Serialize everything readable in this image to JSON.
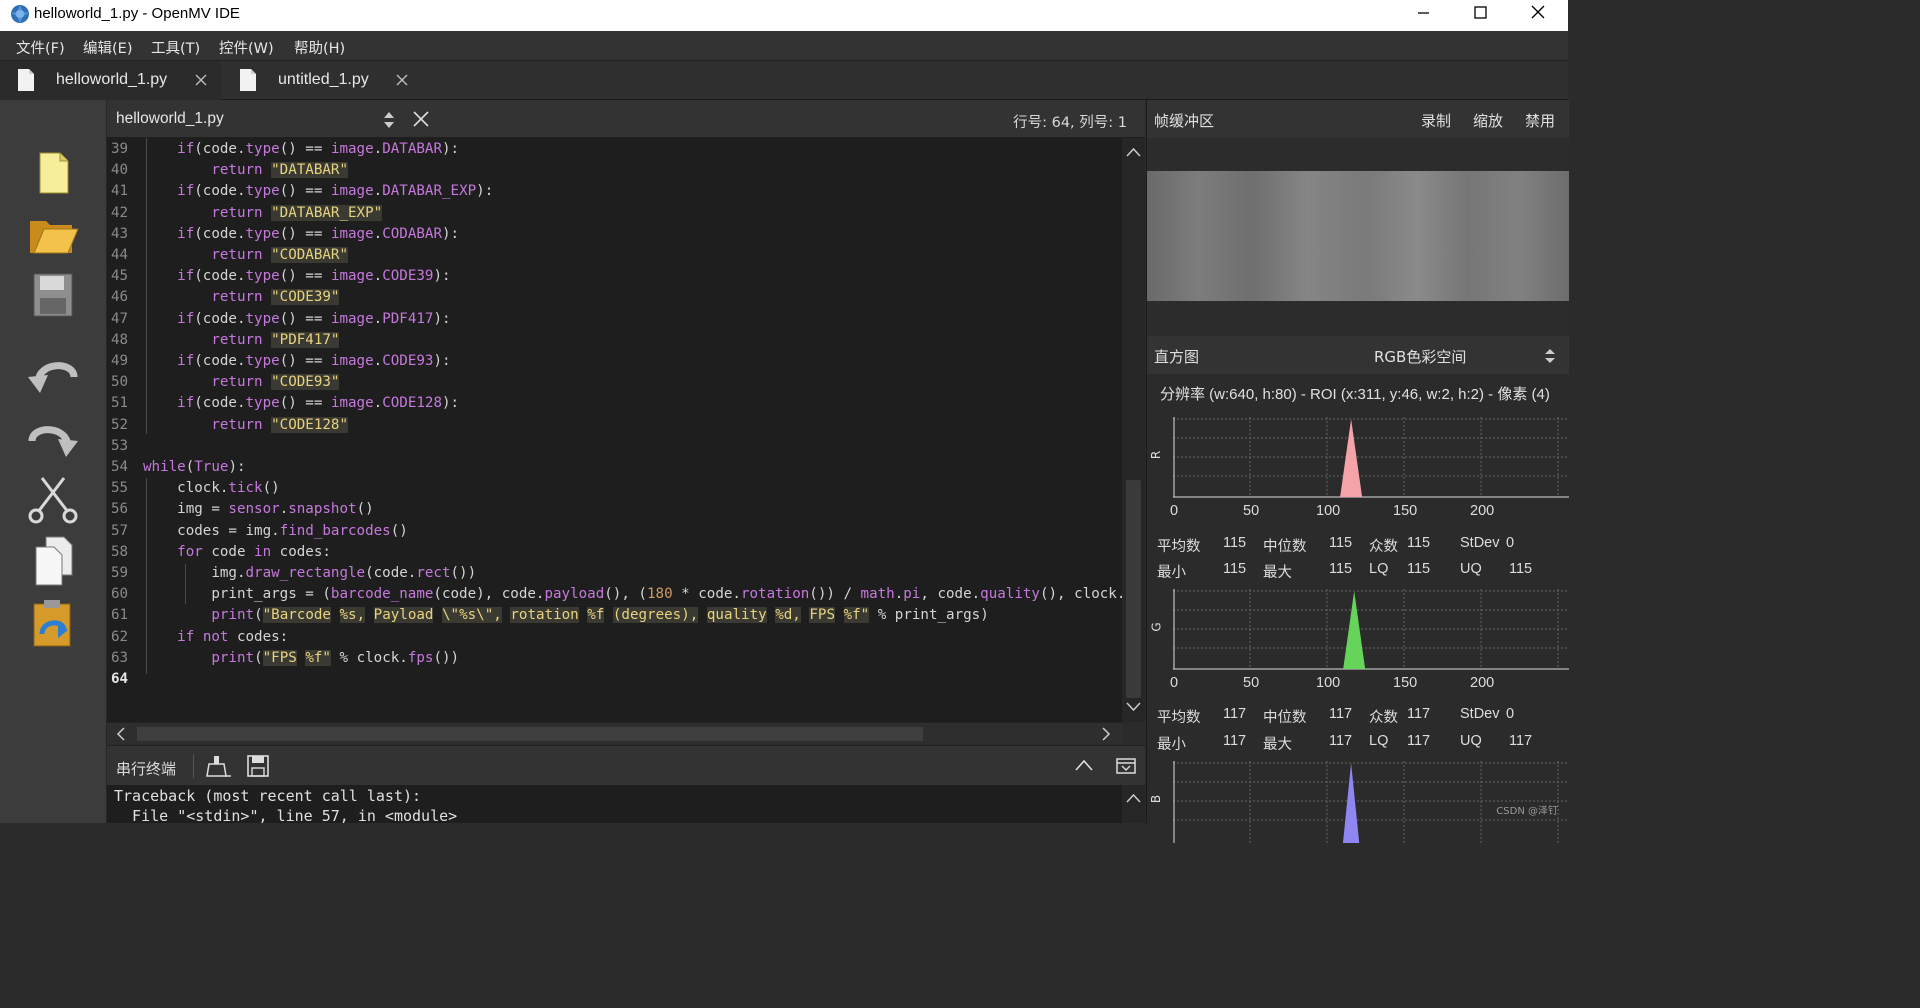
{
  "window": {
    "title": "helloworld_1.py - OpenMV IDE"
  },
  "menu": [
    "文件(F)",
    "编辑(E)",
    "工具(T)",
    "控件(W)",
    "帮助(H)"
  ],
  "tabs": [
    {
      "label": "helloworld_1.py",
      "icon": "file-icon",
      "active": true
    },
    {
      "label": "untitled_1.py",
      "icon": "file-icon",
      "active": false
    }
  ],
  "toolbar": [
    "new-file-icon",
    "open-folder-icon",
    "save-icon",
    "undo-icon",
    "redo-icon",
    "cut-icon",
    "copy-icon",
    "paste-icon"
  ],
  "editor": {
    "filename": "helloworld_1.py",
    "position": "行号: 64, 列号: 1",
    "line_numbers": [
      "39",
      "40",
      "41",
      "42",
      "43",
      "44",
      "45",
      "46",
      "47",
      "48",
      "49",
      "50",
      "51",
      "52",
      "53",
      "54",
      "55",
      "56",
      "57",
      "58",
      "59",
      "60",
      "61",
      "62",
      "63",
      "64"
    ],
    "current_line": "64"
  },
  "terminal": {
    "title": "串行终端",
    "lines": [
      "Traceback (most recent call last):",
      "  File \"<stdin>\", line 57, in <module>"
    ]
  },
  "framebuffer": {
    "title": "帧缓冲区",
    "record": "录制",
    "zoom": "缩放",
    "disable": "禁用"
  },
  "histogram": {
    "title": "直方图",
    "colorspace": "RGB色彩空间",
    "resolution": "分辨率 (w:640, h:80) - ROI (x:311, y:46, w:2, h:2) - 像素 (4)",
    "ticks": [
      "0",
      "50",
      "100",
      "150",
      "200"
    ],
    "channels": [
      {
        "name": "R",
        "color": "#f4a3a8",
        "peak": 115,
        "row1": [
          "平均数",
          "115",
          "中位数",
          "115",
          "众数",
          "115",
          "StDev",
          "0"
        ],
        "row2": [
          "最小",
          "115",
          "最大",
          "115",
          "LQ",
          "115",
          "UQ",
          "115"
        ]
      },
      {
        "name": "G",
        "color": "#66d45a",
        "peak": 117,
        "row1": [
          "平均数",
          "117",
          "中位数",
          "117",
          "众数",
          "117",
          "StDev",
          "0"
        ],
        "row2": [
          "最小",
          "117",
          "最大",
          "117",
          "LQ",
          "117",
          "UQ",
          "117"
        ]
      },
      {
        "name": "B",
        "color": "#8f86f2",
        "peak": 115
      }
    ]
  },
  "watermark": "CSDN @泽钉"
}
